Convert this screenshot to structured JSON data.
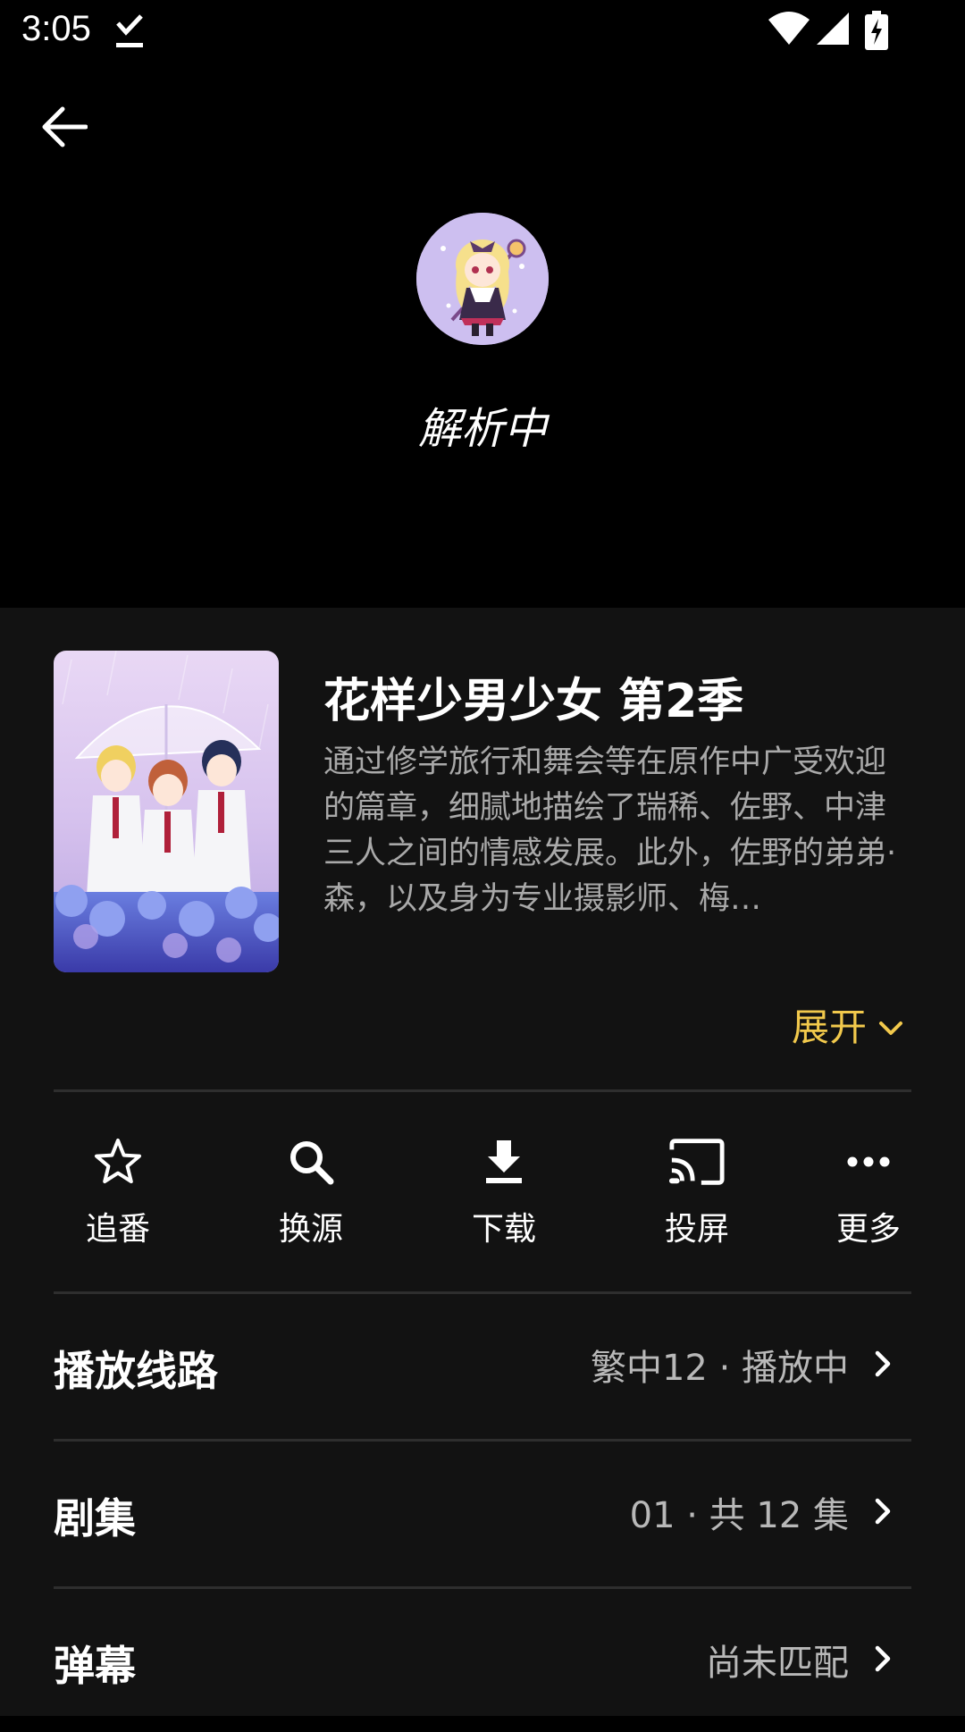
{
  "status_bar": {
    "time": "3:05",
    "icons": [
      "download-done-icon",
      "wifi-icon",
      "signal-icon",
      "battery-charging-icon"
    ]
  },
  "player": {
    "back_icon": "arrow-back-icon",
    "loading_text": "解析中"
  },
  "anime": {
    "title": "花样少男少女 第2季",
    "description": "通过修学旅行和舞会等在原作中广受欢迎的篇章，细腻地描绘了瑞稀、佐野、中津三人之间的情感发展。此外，佐野的弟弟·森，以及身为专业摄影师、梅…",
    "expand_label": "展开"
  },
  "actions": [
    {
      "label": "追番",
      "icon": "star-outline-icon"
    },
    {
      "label": "换源",
      "icon": "search-icon"
    },
    {
      "label": "下载",
      "icon": "download-icon"
    },
    {
      "label": "投屏",
      "icon": "cast-icon"
    },
    {
      "label": "更多",
      "icon": "more-horizontal-icon"
    }
  ],
  "rows": [
    {
      "label": "播放线路",
      "value": "繁中12 · 播放中"
    },
    {
      "label": "剧集",
      "value": "01 · 共 12 集"
    },
    {
      "label": "弹幕",
      "value": "尚未匹配"
    }
  ],
  "colors": {
    "accent": "#f2c94c",
    "background": "#000000",
    "panel": "#121212",
    "secondary_text": "#a9a9a9"
  }
}
